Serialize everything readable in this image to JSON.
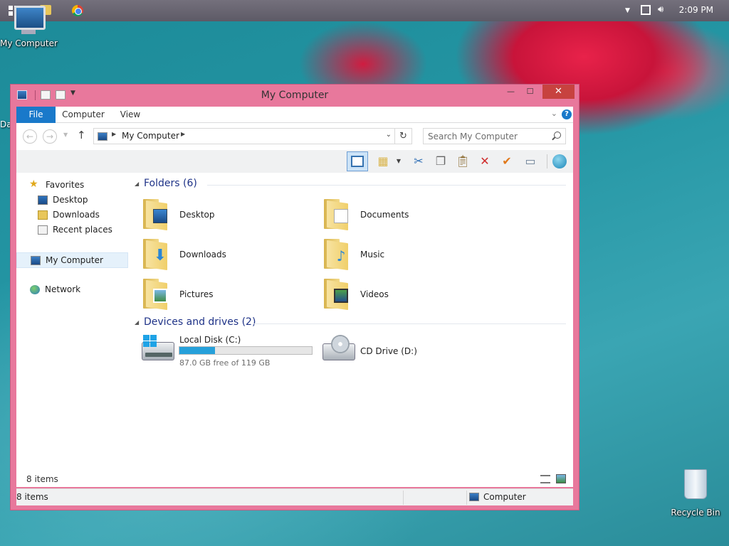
{
  "taskbar": {
    "clock": "2:09 PM",
    "start_icon": "windows-logo",
    "pinned": [
      "folder-icon",
      "chrome-icon"
    ],
    "tray_icons": [
      "show-hidden-icons",
      "network-icon",
      "volume-icon"
    ]
  },
  "desktop": {
    "my_computer_label": "My Computer",
    "recycle_bin_label": "Recycle Bin",
    "clipped_label": "Da"
  },
  "window": {
    "title": "My Computer",
    "controls": {
      "minimize": "—",
      "maximize": "☐",
      "close": "✕"
    }
  },
  "ribbon": {
    "tabs": [
      {
        "label": "File",
        "active": true
      },
      {
        "label": "Computer"
      },
      {
        "label": "View"
      }
    ],
    "help": "?"
  },
  "navbar": {
    "path": "My Computer",
    "search_placeholder": "Search My Computer"
  },
  "navpane": {
    "favorites": "Favorites",
    "favorite_items": [
      "Desktop",
      "Downloads",
      "Recent places"
    ],
    "my_computer": "My Computer",
    "network": "Network"
  },
  "content": {
    "folders_header": "Folders (6)",
    "folders": [
      "Desktop",
      "Documents",
      "Downloads",
      "Music",
      "Pictures",
      "Videos"
    ],
    "drives_header": "Devices and drives (2)",
    "drives": [
      {
        "name": "Local Disk (C:)",
        "free": "87.0 GB free of 119 GB",
        "used_fraction": 0.27
      },
      {
        "name": "CD Drive (D:)"
      }
    ]
  },
  "status": {
    "inner_items": "8 items",
    "items": "8 items",
    "location": "Computer"
  },
  "colors": {
    "window_frame": "#e8789c",
    "file_tab": "#1979ca",
    "close_button": "#c7423f",
    "drive_bar_fill": "#26a0da"
  }
}
